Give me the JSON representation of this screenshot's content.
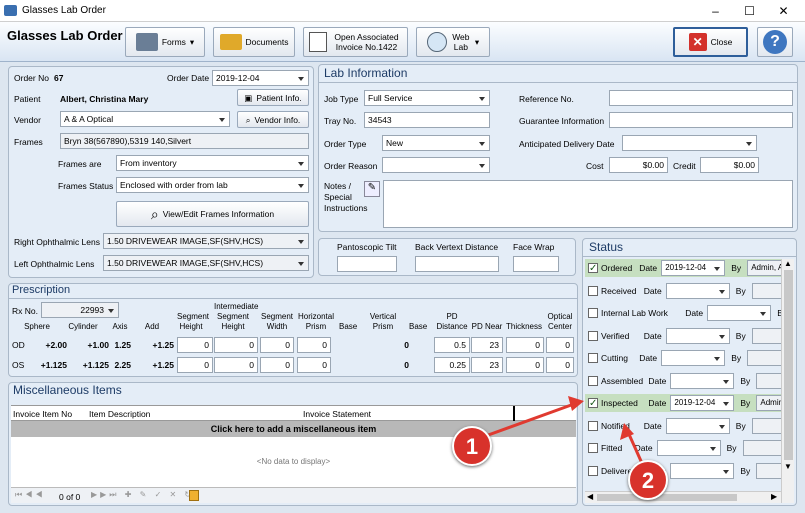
{
  "window": {
    "title": "Glasses Lab Order",
    "minimize": "–",
    "maximize": "☐",
    "close": "✕"
  },
  "toolbar": {
    "heading": "Glasses Lab Order",
    "forms": "Forms",
    "documents": "Documents",
    "open_invoice": "Open Associated Invoice No.1422",
    "web_lab": "Web Lab",
    "close": "Close"
  },
  "order": {
    "order_no_label": "Order No",
    "order_no": "67",
    "order_date_label": "Order Date",
    "order_date": "2019-12-04",
    "patient_label": "Patient",
    "patient": "Albert, Christina Mary",
    "patient_info": "Patient Info.",
    "vendor_label": "Vendor",
    "vendor": "A & A Optical",
    "vendor_info": "Vendor Info.",
    "frames_label": "Frames",
    "frames": "Bryn 38(567890),5319 140,Silvert",
    "frames_are_label": "Frames are",
    "frames_are": "From inventory",
    "frames_status_label": "Frames Status",
    "frames_status": "Enclosed with order from lab",
    "view_frames": "View/Edit Frames Information",
    "right_lens_label": "Right Ophthalmic Lens",
    "right_lens": "1.50 DRIVEWEAR IMAGE,SF(SHV,HCS)",
    "left_lens_label": "Left Ophthalmic Lens",
    "left_lens": "1.50 DRIVEWEAR IMAGE,SF(SHV,HCS)"
  },
  "lab": {
    "title": "Lab Information",
    "job_type_label": "Job Type",
    "job_type": "Full Service",
    "tray_no_label": "Tray No.",
    "tray_no": "34543",
    "order_type_label": "Order Type",
    "order_type": "New",
    "order_reason_label": "Order Reason",
    "order_reason": "",
    "notes_label": "Notes / Special Instructions",
    "reference_label": "Reference No.",
    "reference": "",
    "guarantee_label": "Guarantee Information",
    "guarantee": "",
    "delivery_label": "Anticipated Delivery Date",
    "delivery": "",
    "cost_label": "Cost",
    "cost": "$0.00",
    "credit_label": "Credit",
    "credit": "$0.00"
  },
  "measures": {
    "pantoscopic": "Pantoscopic Tilt",
    "back_vertex": "Back Vertext Distance",
    "face_wrap": "Face Wrap"
  },
  "prescription": {
    "title": "Prescription",
    "rx_label": "Rx No.",
    "rx_no": "22993",
    "headers": [
      "Sphere",
      "Cylinder",
      "Axis",
      "Add",
      "Segment Height",
      "Intermediate Segment Height",
      "Segment Width",
      "Horizontal Prism",
      "Base",
      "Vertical Prism",
      "Base",
      "PD Distance",
      "PD Near",
      "Thickness",
      "Optical Center"
    ],
    "rows": [
      {
        "eye": "OD",
        "sphere": "+2.00",
        "cylinder": "+1.00",
        "axis": "1.25",
        "add": "+1.25",
        "seg_h": "0",
        "int_seg": "0",
        "seg_w": "0",
        "h_prism": "0",
        "v_prism": "0",
        "pd_dist": "0.5",
        "pd_near": "23",
        "thick": "0",
        "oc": "0"
      },
      {
        "eye": "OS",
        "sphere": "+1.125",
        "cylinder": "+1.125",
        "axis": "2.25",
        "add": "+1.25",
        "seg_h": "0",
        "int_seg": "0",
        "seg_w": "0",
        "h_prism": "0",
        "v_prism": "0",
        "pd_dist": "0.25",
        "pd_near": "23",
        "thick": "0",
        "oc": "0"
      }
    ]
  },
  "misc": {
    "title": "Miscellaneous Items",
    "col1": "Invoice Item No",
    "col2": "Item Description",
    "col3": "Invoice Statement",
    "add_row": "Click here to add a miscellaneous item",
    "empty": "<No data to display>",
    "pager": "0 of 0"
  },
  "status": {
    "title": "Status",
    "date_label": "Date",
    "by_label": "By",
    "items": [
      {
        "label": "Ordered",
        "checked": true,
        "date": "2019-12-04",
        "by": "Admin, A"
      },
      {
        "label": "Received",
        "checked": false,
        "date": "",
        "by": ""
      },
      {
        "label": "Internal Lab Work",
        "checked": false,
        "date": "",
        "by": ""
      },
      {
        "label": "Verified",
        "checked": false,
        "date": "",
        "by": ""
      },
      {
        "label": "Cutting",
        "checked": false,
        "date": "",
        "by": ""
      },
      {
        "label": "Assembled",
        "checked": false,
        "date": "",
        "by": ""
      },
      {
        "label": "Inspected",
        "checked": true,
        "date": "2019-12-04",
        "by": "Admin,"
      },
      {
        "label": "Notified",
        "checked": false,
        "date": "",
        "by": ""
      },
      {
        "label": "Fitted",
        "checked": false,
        "date": "",
        "by": ""
      },
      {
        "label": "Delivered",
        "checked": false,
        "date": "",
        "by": ""
      }
    ]
  },
  "annotations": {
    "one": "1",
    "two": "2"
  },
  "colors": {
    "accent": "#1d3b66",
    "checked_row": "#c6dfc0",
    "badge": "#d8322b"
  }
}
